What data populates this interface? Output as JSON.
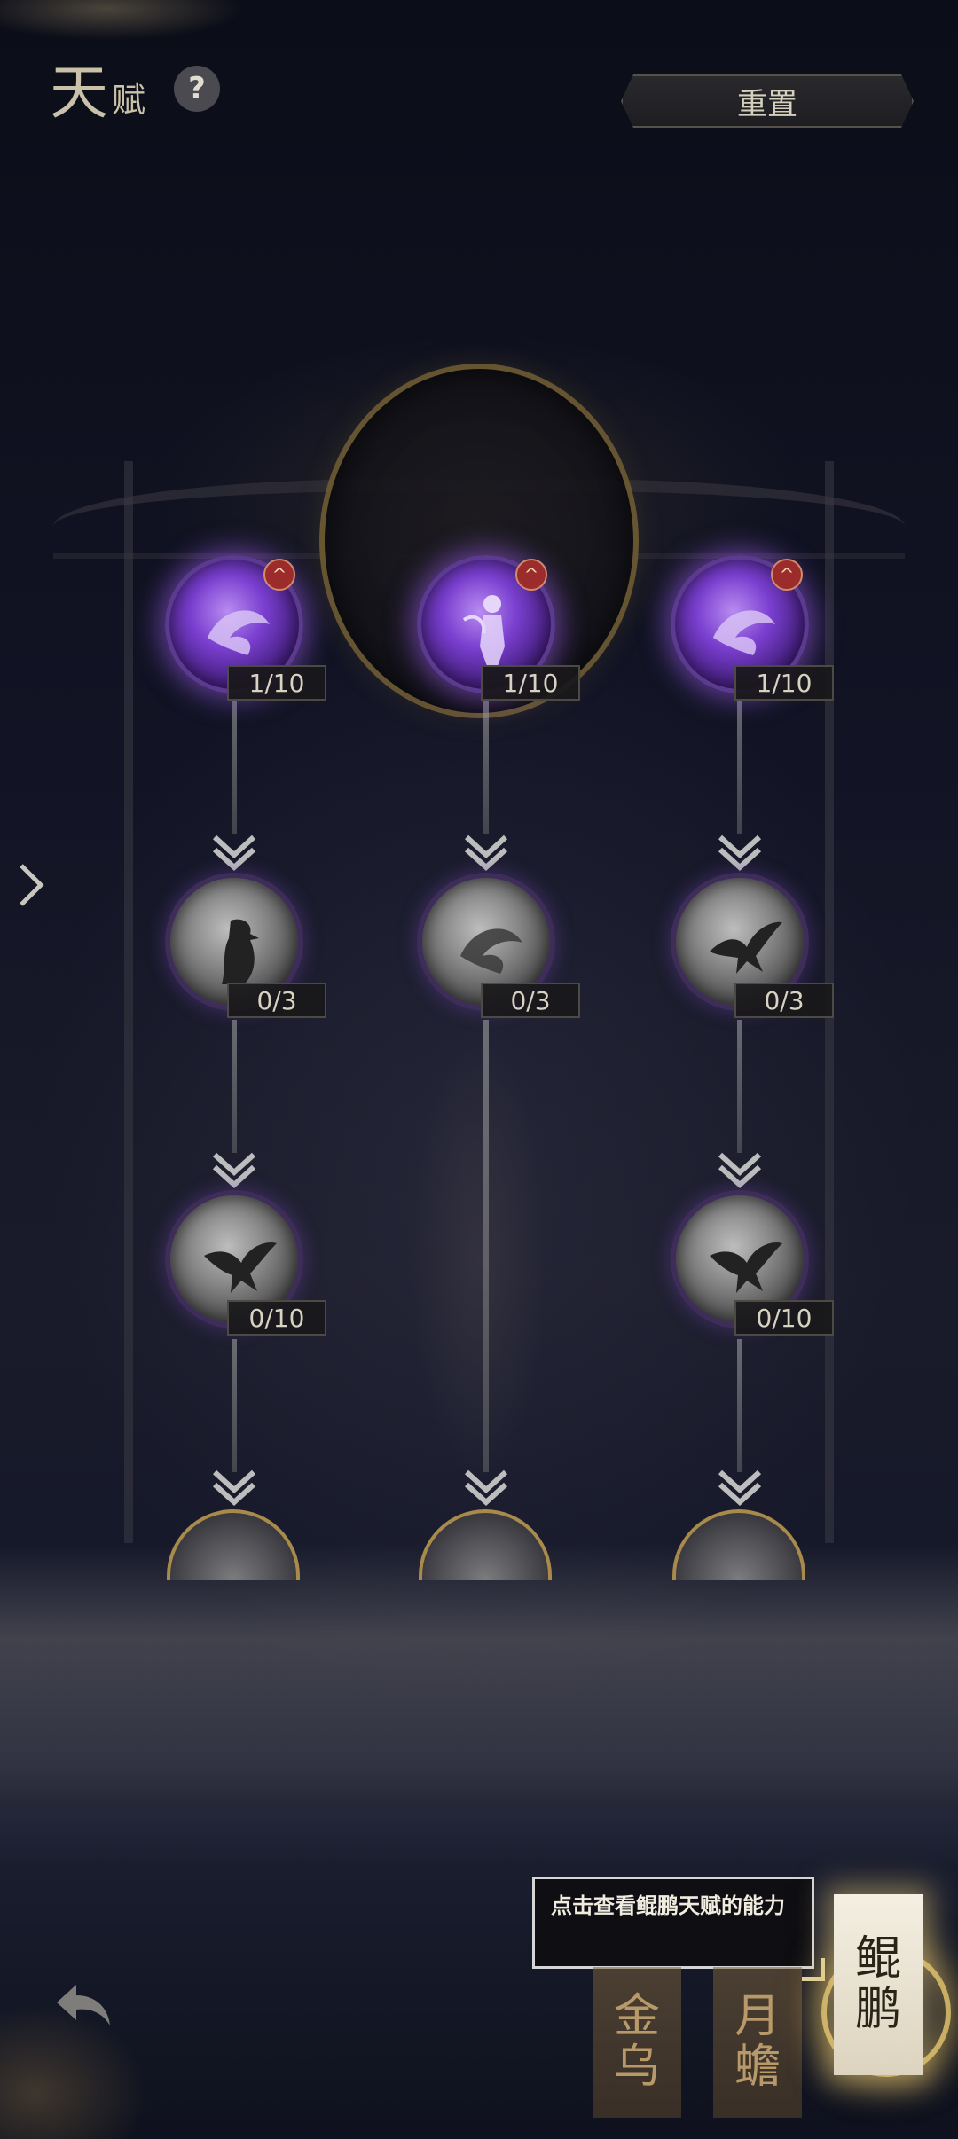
{
  "header": {
    "title_big": "天",
    "title_small": "赋",
    "help_label": "?",
    "reset_label": "重置"
  },
  "talent_tree": {
    "row1": [
      {
        "level": "1/10",
        "state": "active",
        "upgrade_badge": "^",
        "icon": "fish-icon"
      },
      {
        "level": "1/10",
        "state": "active",
        "upgrade_badge": "^",
        "icon": "figure-icon"
      },
      {
        "level": "1/10",
        "state": "active",
        "upgrade_badge": "^",
        "icon": "fish-icon"
      }
    ],
    "row2": [
      {
        "level": "0/3",
        "state": "locked",
        "icon": "eagle-icon"
      },
      {
        "level": "0/3",
        "state": "locked",
        "icon": "fish-icon"
      },
      {
        "level": "0/3",
        "state": "locked",
        "icon": "bird-icon"
      }
    ],
    "row3": [
      {
        "level": "0/10",
        "state": "locked",
        "icon": "bird-icon"
      },
      {
        "level": "0/10",
        "state": "locked",
        "icon": "bird-icon"
      }
    ]
  },
  "hint": {
    "text": "点击查看鲲鹏天赋的能力"
  },
  "beast_tabs": [
    {
      "label_top": "金",
      "label_bottom": "乌",
      "selected": false
    },
    {
      "label_top": "月",
      "label_bottom": "蟾",
      "selected": false
    },
    {
      "label_top": "鲲",
      "label_bottom": "鹏",
      "selected": true
    }
  ],
  "colors": {
    "active_node": "#7a3fd0",
    "locked_node": "#8a8a8a",
    "accent_gold": "#c9a24e",
    "badge_red": "#9c2b2b"
  }
}
